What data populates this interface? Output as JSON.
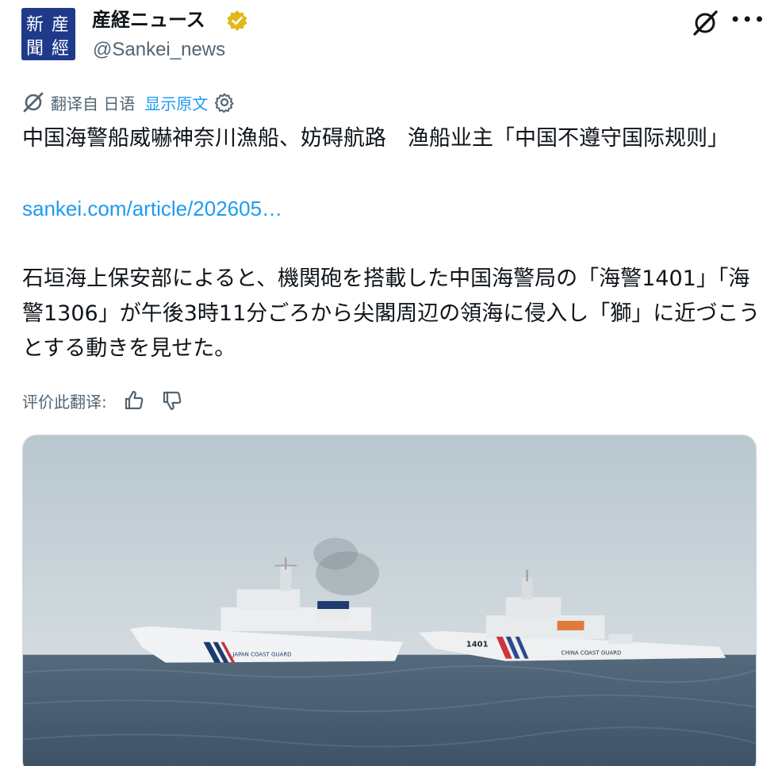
{
  "account": {
    "display_name": "産経ニュース",
    "handle": "@Sankei_news",
    "avatar_text": "産經新聞",
    "verified_icon": "gold-verified-badge",
    "verified_color": "#e2b719"
  },
  "translation": {
    "from_label": "翻译自 日语",
    "show_original": "显示原文",
    "rate_label": "评价此翻译:"
  },
  "post": {
    "title": "中国海警船威嚇神奈川漁船、妨碍航路　渔船业主「中国不遵守国际规则」",
    "link": "sankei.com/article/202605…",
    "body": "石垣海上保安部によると、機関砲を搭載した中国海警局の「海警1401」「海警1306」が午後3時11分ごろから尖閣周辺の領海に侵入し「獅」に近づこうとする動きを見せた。"
  },
  "media": {
    "ship_left_hull_label": "JAPAN COAST GUARD",
    "ship_right_hull_number": "1401",
    "ship_right_hull_label": "CHINA COAST GUARD"
  },
  "colors": {
    "link": "#1d9bf0",
    "secondary_text": "#536471",
    "sea": "#4a6178",
    "sky": "#c9d3d8"
  }
}
